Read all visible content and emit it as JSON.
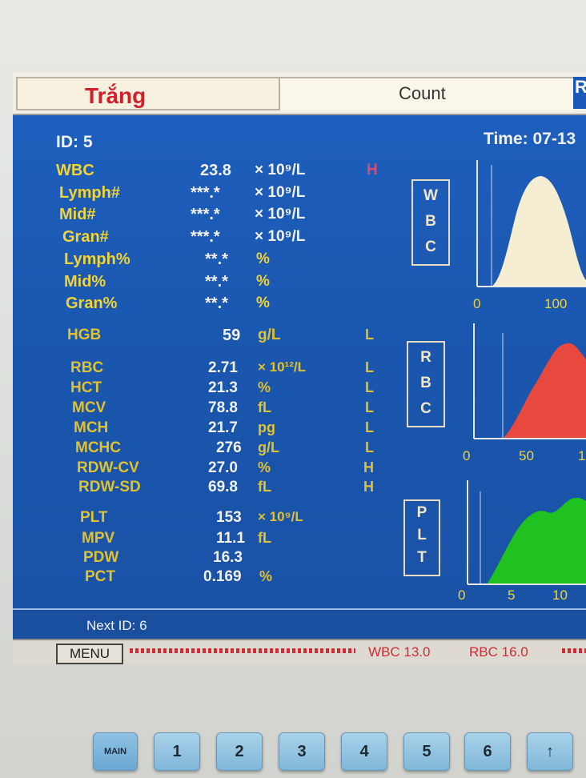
{
  "tabs": {
    "left": "Trắng",
    "middle": "Count",
    "right": "R"
  },
  "header": {
    "id": "ID: 5",
    "time": "Time: 07-13"
  },
  "wbc_rows": [
    {
      "name": "WBC",
      "value": "23.8",
      "unit": "× 10⁹/L",
      "flag": "H"
    },
    {
      "name": "Lymph#",
      "value": "***.*",
      "unit": "× 10⁹/L",
      "flag": ""
    },
    {
      "name": "Mid#",
      "value": "***.*",
      "unit": "× 10⁹/L",
      "flag": ""
    },
    {
      "name": "Gran#",
      "value": "***.*",
      "unit": "× 10⁹/L",
      "flag": ""
    },
    {
      "name": "Lymph%",
      "value": "**.*",
      "unit": "%",
      "flag": ""
    },
    {
      "name": "Mid%",
      "value": "**.*",
      "unit": "%",
      "flag": ""
    },
    {
      "name": "Gran%",
      "value": "**.*",
      "unit": "%",
      "flag": ""
    }
  ],
  "hgb_row": {
    "name": "HGB",
    "value": "59",
    "unit": "g/L",
    "flag": "L"
  },
  "rbc_rows": [
    {
      "name": "RBC",
      "value": "2.71",
      "unit": "× 10¹²/L",
      "flag": "L"
    },
    {
      "name": "HCT",
      "value": "21.3",
      "unit": "%",
      "flag": "L"
    },
    {
      "name": "MCV",
      "value": "78.8",
      "unit": "fL",
      "flag": "L"
    },
    {
      "name": "MCH",
      "value": "21.7",
      "unit": "pg",
      "flag": "L"
    },
    {
      "name": "MCHC",
      "value": "276",
      "unit": "g/L",
      "flag": "L"
    },
    {
      "name": "RDW-CV",
      "value": "27.0",
      "unit": "%",
      "flag": "H"
    },
    {
      "name": "RDW-SD",
      "value": "69.8",
      "unit": "fL",
      "flag": "H"
    }
  ],
  "plt_rows": [
    {
      "name": "PLT",
      "value": "153",
      "unit": "× 10⁹/L",
      "flag": ""
    },
    {
      "name": "MPV",
      "value": "11.1",
      "unit": "fL",
      "flag": ""
    },
    {
      "name": "PDW",
      "value": "16.3",
      "unit": "",
      "flag": ""
    },
    {
      "name": "PCT",
      "value": "0.169",
      "unit": "%",
      "flag": ""
    }
  ],
  "histogram_boxes": {
    "wbc": [
      "W",
      "B",
      "C"
    ],
    "rbc": [
      "R",
      "B",
      "C"
    ],
    "plt": [
      "P",
      "L",
      "T"
    ]
  },
  "histograms": {
    "wbc": {
      "color": "#f6eed2",
      "ticks": [
        "0",
        "100"
      ]
    },
    "rbc": {
      "color": "#e8493f",
      "ticks": [
        "0",
        "50",
        "1"
      ]
    },
    "plt": {
      "color": "#1fc21f",
      "ticks": [
        "0",
        "5",
        "10"
      ]
    }
  },
  "status": {
    "next_id": "Next ID: 6"
  },
  "bottom": {
    "menu": "MENU",
    "alarm_wbc": "WBC 13.0",
    "alarm_rbc": "RBC 16.0"
  },
  "keys": [
    "MAIN",
    "1",
    "2",
    "3",
    "4",
    "5",
    "6",
    "↑"
  ],
  "colors": {
    "panel_blue": "#1e5fbd",
    "label_yellow": "#f2d434",
    "value_white": "#f2f2f2",
    "flag_red": "#e04a6b"
  }
}
